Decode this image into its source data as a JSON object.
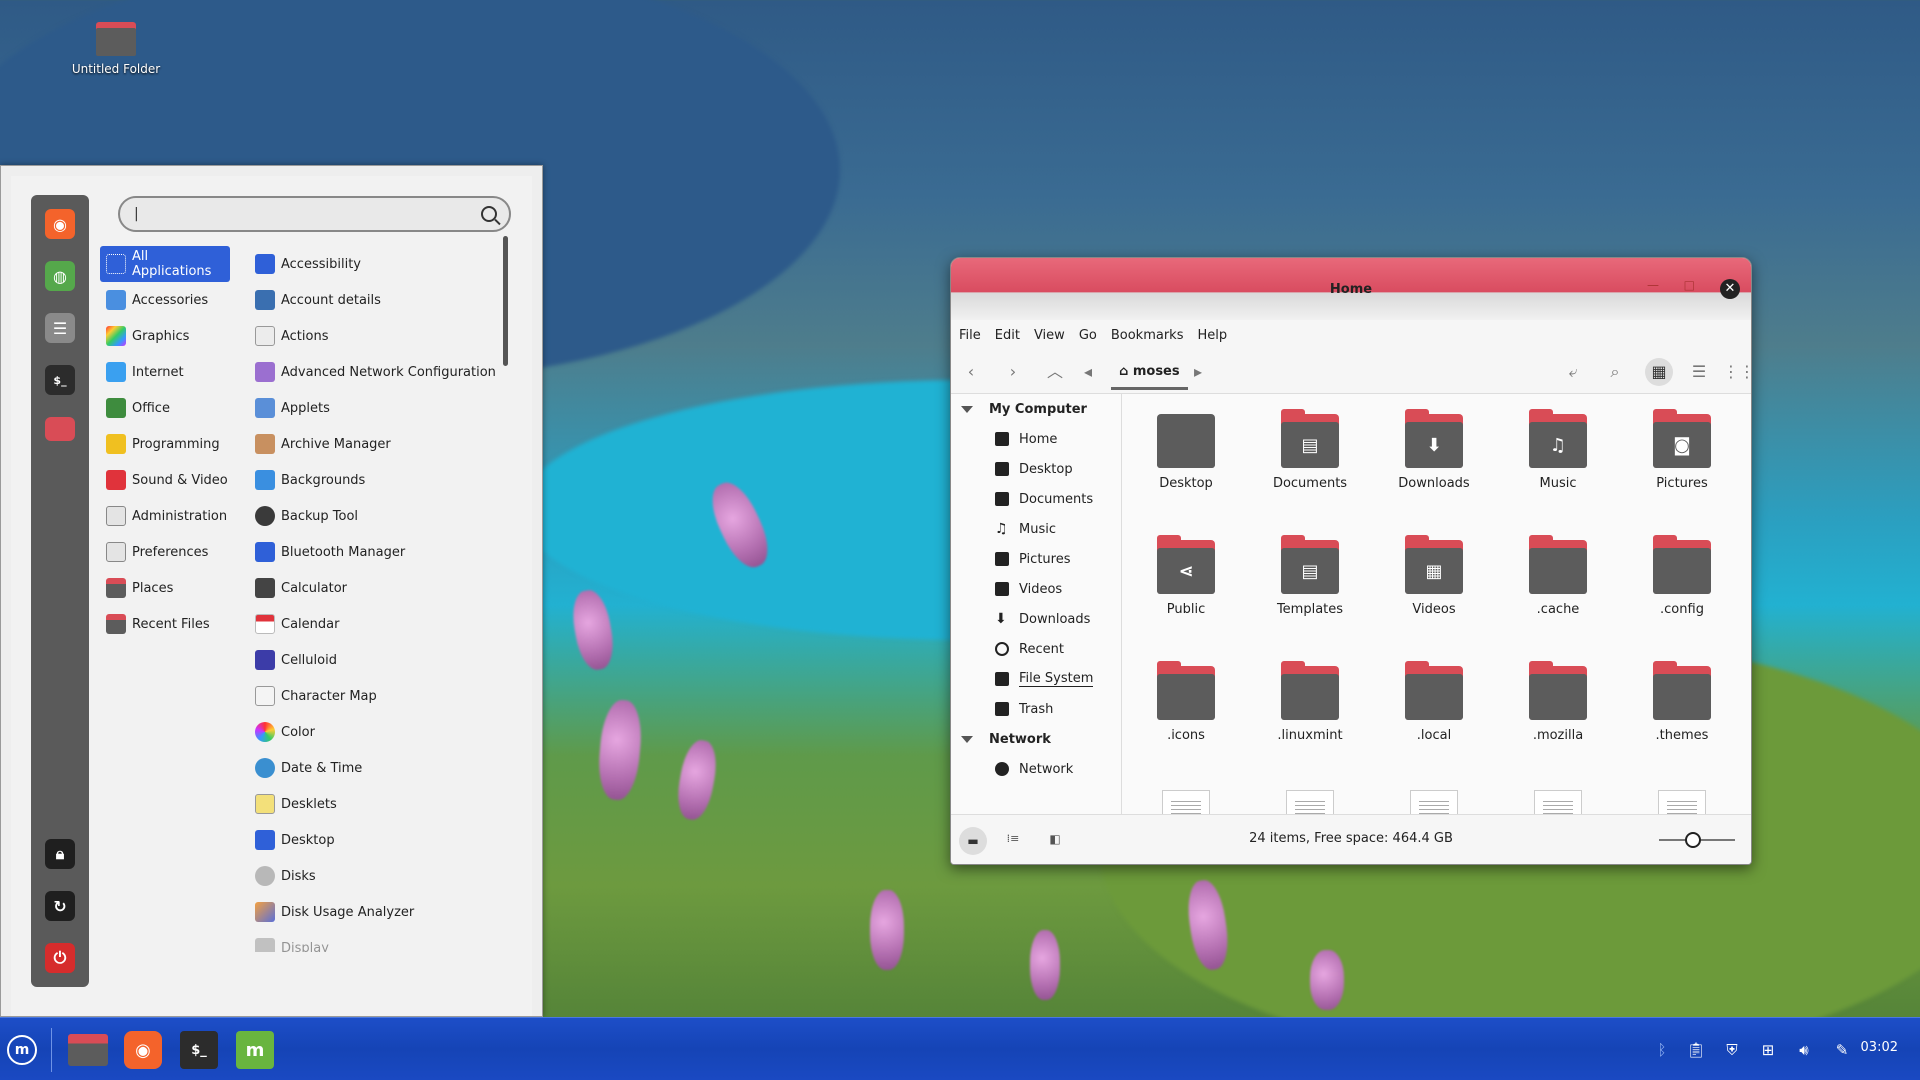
{
  "desktop": {
    "icons": [
      {
        "label": "Untitled Folder"
      }
    ]
  },
  "menu": {
    "search": {
      "value": "|"
    },
    "favorites": [
      {
        "name": "firefox",
        "color": "#f4632b"
      },
      {
        "name": "software-manager",
        "color": "#55a84b"
      },
      {
        "name": "settings",
        "color": "#6c6c6c"
      },
      {
        "name": "terminal",
        "color": "#2c2c2c"
      },
      {
        "name": "files",
        "color": "#d94c56"
      },
      {
        "name": "lock-screen",
        "color": "#1f1f1f"
      },
      {
        "name": "logout",
        "color": "#1f1f1f"
      },
      {
        "name": "power-off",
        "color": "#d62c2c"
      }
    ],
    "categories": [
      {
        "label": "All Applications",
        "active": true
      },
      {
        "label": "Accessories"
      },
      {
        "label": "Graphics"
      },
      {
        "label": "Internet"
      },
      {
        "label": "Office"
      },
      {
        "label": "Programming"
      },
      {
        "label": "Sound & Video"
      },
      {
        "label": "Administration"
      },
      {
        "label": "Preferences"
      },
      {
        "label": "Places"
      },
      {
        "label": "Recent Files"
      }
    ],
    "apps": [
      {
        "label": "Accessibility"
      },
      {
        "label": "Account details"
      },
      {
        "label": "Actions"
      },
      {
        "label": "Advanced Network Configuration"
      },
      {
        "label": "Applets"
      },
      {
        "label": "Archive Manager"
      },
      {
        "label": "Backgrounds"
      },
      {
        "label": "Backup Tool"
      },
      {
        "label": "Bluetooth Manager"
      },
      {
        "label": "Calculator"
      },
      {
        "label": "Calendar"
      },
      {
        "label": "Celluloid"
      },
      {
        "label": "Character Map"
      },
      {
        "label": "Color"
      },
      {
        "label": "Date & Time"
      },
      {
        "label": "Desklets"
      },
      {
        "label": "Desktop"
      },
      {
        "label": "Disks"
      },
      {
        "label": "Disk Usage Analyzer"
      },
      {
        "label": "Display"
      }
    ]
  },
  "file_manager": {
    "title": "Home",
    "menubar": [
      "File",
      "Edit",
      "View",
      "Go",
      "Bookmarks",
      "Help"
    ],
    "breadcrumb": "moses",
    "sidebar": {
      "sections": [
        {
          "heading": "My Computer",
          "items": [
            "Home",
            "Desktop",
            "Documents",
            "Music",
            "Pictures",
            "Videos",
            "Downloads",
            "Recent",
            "File System",
            "Trash"
          ]
        },
        {
          "heading": "Network",
          "items": [
            "Network"
          ]
        }
      ]
    },
    "items": [
      {
        "label": "Desktop",
        "glyph": ""
      },
      {
        "label": "Documents",
        "glyph": "▤"
      },
      {
        "label": "Downloads",
        "glyph": "⬇"
      },
      {
        "label": "Music",
        "glyph": "♫"
      },
      {
        "label": "Pictures",
        "glyph": "◙"
      },
      {
        "label": "Public",
        "glyph": "⋖"
      },
      {
        "label": "Templates",
        "glyph": "▤"
      },
      {
        "label": "Videos",
        "glyph": "▦"
      },
      {
        "label": ".cache",
        "glyph": ""
      },
      {
        "label": ".config",
        "glyph": ""
      },
      {
        "label": ".icons",
        "glyph": ""
      },
      {
        "label": ".linuxmint",
        "glyph": ""
      },
      {
        "label": ".local",
        "glyph": ""
      },
      {
        "label": ".mozilla",
        "glyph": ""
      },
      {
        "label": ".themes",
        "glyph": ""
      }
    ],
    "status": "24 items, Free space: 464.4 GB",
    "zoom_level": 0.45
  },
  "taskbar": {
    "apps": [
      {
        "name": "menu-button",
        "color": "#1a49c2"
      },
      {
        "name": "files",
        "color": "#d94c56"
      },
      {
        "name": "firefox",
        "color": "#f4632b"
      },
      {
        "name": "terminal",
        "color": "#2c2c2c"
      },
      {
        "name": "mint-update",
        "color": "#69b53f"
      }
    ],
    "clock": "03:02"
  },
  "colors": {
    "accent": "#2f60d8",
    "folder_red": "#d94c56",
    "taskbar": "#1a49c2"
  }
}
